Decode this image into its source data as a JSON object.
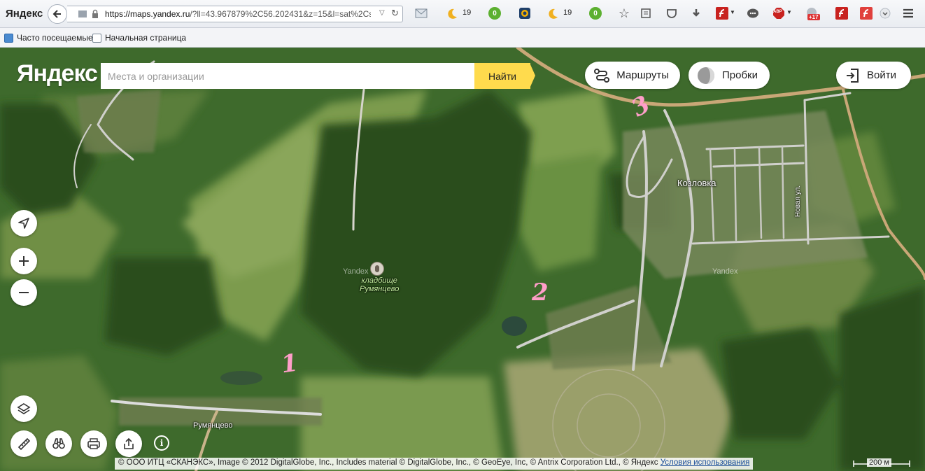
{
  "browser": {
    "brand": "Яндекс",
    "url_base": "https://maps.yandex.ru",
    "url_rest": "/?ll=43.967879%2C56.202431&z=15&l=sat%2Cskl",
    "badge_weather_1": "19",
    "badge_zero_1": "0",
    "badge_weather_2": "19",
    "badge_zero_2": "0",
    "badge_abp": "ABP",
    "badge_plus": "+17",
    "bookmarks": [
      {
        "label": "Часто посещаемые"
      },
      {
        "label": "Начальная страница"
      }
    ]
  },
  "map": {
    "logo": "Яндекс",
    "search": {
      "placeholder": "Места и организации",
      "button": "Найти"
    },
    "routes_label": "Маршруты",
    "traffic_label": "Пробки",
    "login_label": "Войти",
    "labels": {
      "cemetery_line1": "кладбище",
      "cemetery_line2": "Румянцево",
      "village_kozlovka": "Козловка",
      "village_rumyantsevo": "Румянцево",
      "street_novaya": "Новая ул."
    },
    "watermarks": [
      "Yandex",
      "Yandex"
    ],
    "annotations": [
      "1",
      "2",
      "3"
    ],
    "copyright": "© ООО ИТЦ «СКАНЭКС», Image © 2012 DigitalGlobe, Inc., Includes material © DigitalGlobe, Inc., © GeoEye, Inc, © Antrix Corporation Ltd., © Яндекс",
    "terms_link": "Условия использования",
    "scale": "200 м"
  }
}
